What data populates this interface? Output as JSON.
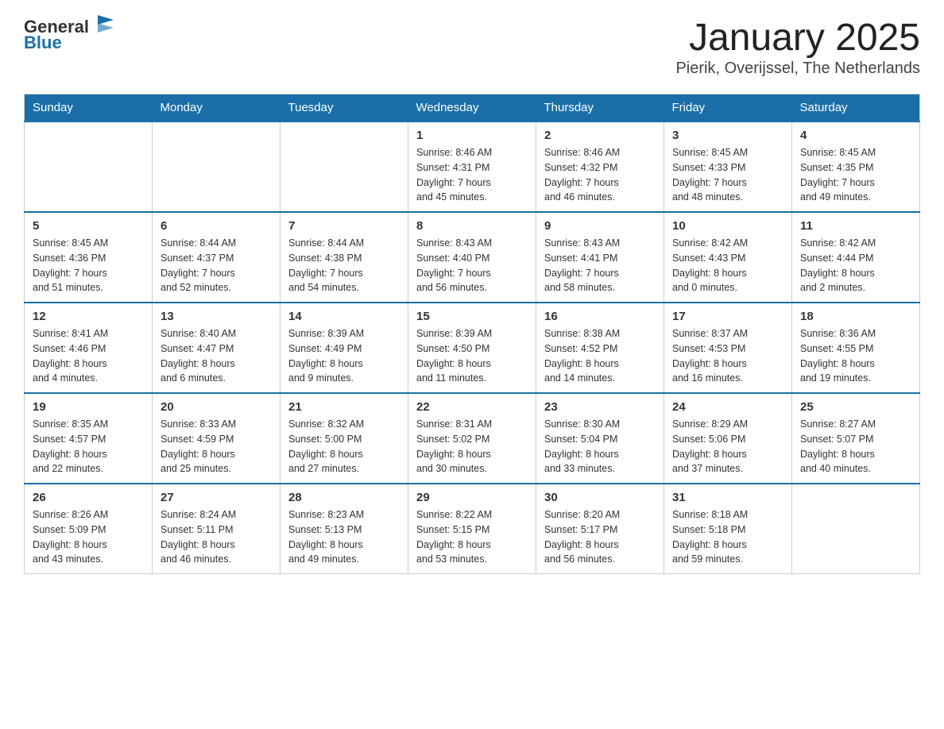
{
  "header": {
    "logo_text_general": "General",
    "logo_text_blue": "Blue",
    "month_title": "January 2025",
    "location": "Pierik, Overijssel, The Netherlands"
  },
  "days_of_week": [
    "Sunday",
    "Monday",
    "Tuesday",
    "Wednesday",
    "Thursday",
    "Friday",
    "Saturday"
  ],
  "weeks": [
    [
      {
        "day": "",
        "info": ""
      },
      {
        "day": "",
        "info": ""
      },
      {
        "day": "",
        "info": ""
      },
      {
        "day": "1",
        "info": "Sunrise: 8:46 AM\nSunset: 4:31 PM\nDaylight: 7 hours\nand 45 minutes."
      },
      {
        "day": "2",
        "info": "Sunrise: 8:46 AM\nSunset: 4:32 PM\nDaylight: 7 hours\nand 46 minutes."
      },
      {
        "day": "3",
        "info": "Sunrise: 8:45 AM\nSunset: 4:33 PM\nDaylight: 7 hours\nand 48 minutes."
      },
      {
        "day": "4",
        "info": "Sunrise: 8:45 AM\nSunset: 4:35 PM\nDaylight: 7 hours\nand 49 minutes."
      }
    ],
    [
      {
        "day": "5",
        "info": "Sunrise: 8:45 AM\nSunset: 4:36 PM\nDaylight: 7 hours\nand 51 minutes."
      },
      {
        "day": "6",
        "info": "Sunrise: 8:44 AM\nSunset: 4:37 PM\nDaylight: 7 hours\nand 52 minutes."
      },
      {
        "day": "7",
        "info": "Sunrise: 8:44 AM\nSunset: 4:38 PM\nDaylight: 7 hours\nand 54 minutes."
      },
      {
        "day": "8",
        "info": "Sunrise: 8:43 AM\nSunset: 4:40 PM\nDaylight: 7 hours\nand 56 minutes."
      },
      {
        "day": "9",
        "info": "Sunrise: 8:43 AM\nSunset: 4:41 PM\nDaylight: 7 hours\nand 58 minutes."
      },
      {
        "day": "10",
        "info": "Sunrise: 8:42 AM\nSunset: 4:43 PM\nDaylight: 8 hours\nand 0 minutes."
      },
      {
        "day": "11",
        "info": "Sunrise: 8:42 AM\nSunset: 4:44 PM\nDaylight: 8 hours\nand 2 minutes."
      }
    ],
    [
      {
        "day": "12",
        "info": "Sunrise: 8:41 AM\nSunset: 4:46 PM\nDaylight: 8 hours\nand 4 minutes."
      },
      {
        "day": "13",
        "info": "Sunrise: 8:40 AM\nSunset: 4:47 PM\nDaylight: 8 hours\nand 6 minutes."
      },
      {
        "day": "14",
        "info": "Sunrise: 8:39 AM\nSunset: 4:49 PM\nDaylight: 8 hours\nand 9 minutes."
      },
      {
        "day": "15",
        "info": "Sunrise: 8:39 AM\nSunset: 4:50 PM\nDaylight: 8 hours\nand 11 minutes."
      },
      {
        "day": "16",
        "info": "Sunrise: 8:38 AM\nSunset: 4:52 PM\nDaylight: 8 hours\nand 14 minutes."
      },
      {
        "day": "17",
        "info": "Sunrise: 8:37 AM\nSunset: 4:53 PM\nDaylight: 8 hours\nand 16 minutes."
      },
      {
        "day": "18",
        "info": "Sunrise: 8:36 AM\nSunset: 4:55 PM\nDaylight: 8 hours\nand 19 minutes."
      }
    ],
    [
      {
        "day": "19",
        "info": "Sunrise: 8:35 AM\nSunset: 4:57 PM\nDaylight: 8 hours\nand 22 minutes."
      },
      {
        "day": "20",
        "info": "Sunrise: 8:33 AM\nSunset: 4:59 PM\nDaylight: 8 hours\nand 25 minutes."
      },
      {
        "day": "21",
        "info": "Sunrise: 8:32 AM\nSunset: 5:00 PM\nDaylight: 8 hours\nand 27 minutes."
      },
      {
        "day": "22",
        "info": "Sunrise: 8:31 AM\nSunset: 5:02 PM\nDaylight: 8 hours\nand 30 minutes."
      },
      {
        "day": "23",
        "info": "Sunrise: 8:30 AM\nSunset: 5:04 PM\nDaylight: 8 hours\nand 33 minutes."
      },
      {
        "day": "24",
        "info": "Sunrise: 8:29 AM\nSunset: 5:06 PM\nDaylight: 8 hours\nand 37 minutes."
      },
      {
        "day": "25",
        "info": "Sunrise: 8:27 AM\nSunset: 5:07 PM\nDaylight: 8 hours\nand 40 minutes."
      }
    ],
    [
      {
        "day": "26",
        "info": "Sunrise: 8:26 AM\nSunset: 5:09 PM\nDaylight: 8 hours\nand 43 minutes."
      },
      {
        "day": "27",
        "info": "Sunrise: 8:24 AM\nSunset: 5:11 PM\nDaylight: 8 hours\nand 46 minutes."
      },
      {
        "day": "28",
        "info": "Sunrise: 8:23 AM\nSunset: 5:13 PM\nDaylight: 8 hours\nand 49 minutes."
      },
      {
        "day": "29",
        "info": "Sunrise: 8:22 AM\nSunset: 5:15 PM\nDaylight: 8 hours\nand 53 minutes."
      },
      {
        "day": "30",
        "info": "Sunrise: 8:20 AM\nSunset: 5:17 PM\nDaylight: 8 hours\nand 56 minutes."
      },
      {
        "day": "31",
        "info": "Sunrise: 8:18 AM\nSunset: 5:18 PM\nDaylight: 8 hours\nand 59 minutes."
      },
      {
        "day": "",
        "info": ""
      }
    ]
  ]
}
